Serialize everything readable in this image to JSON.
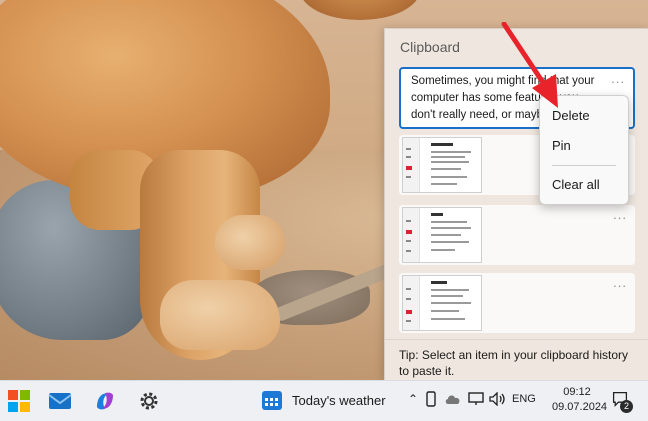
{
  "clipboard": {
    "title": "Clipboard",
    "items": [
      {
        "type": "text",
        "text": "Sometimes, you might find that your computer has some features you don't really need, or maybe",
        "more": "..."
      },
      {
        "type": "image",
        "more": "..."
      },
      {
        "type": "image",
        "more": "..."
      },
      {
        "type": "image",
        "more": "..."
      }
    ],
    "tip": "Tip: Select an item in your clipboard history to paste it."
  },
  "context_menu": {
    "items": [
      "Delete",
      "Pin",
      "Clear all"
    ]
  },
  "annotation": {
    "arrow_color": "#e8242a"
  },
  "taskbar": {
    "apps": [
      "start-icon",
      "mail-icon",
      "copilot-icon",
      "settings-icon"
    ],
    "weather_text": "Today's weather",
    "tray_icons": [
      "chevron-up-icon",
      "phone-link-icon",
      "cloud-icon",
      "network-icon",
      "volume-icon"
    ],
    "language": "ENG",
    "time": "09:12",
    "date": "09.07.2024",
    "notification_count": "2"
  },
  "colors": {
    "accent": "#1a6fc9",
    "flyout_bg": "#efe7df",
    "taskbar_bg": "#eef0f3"
  }
}
